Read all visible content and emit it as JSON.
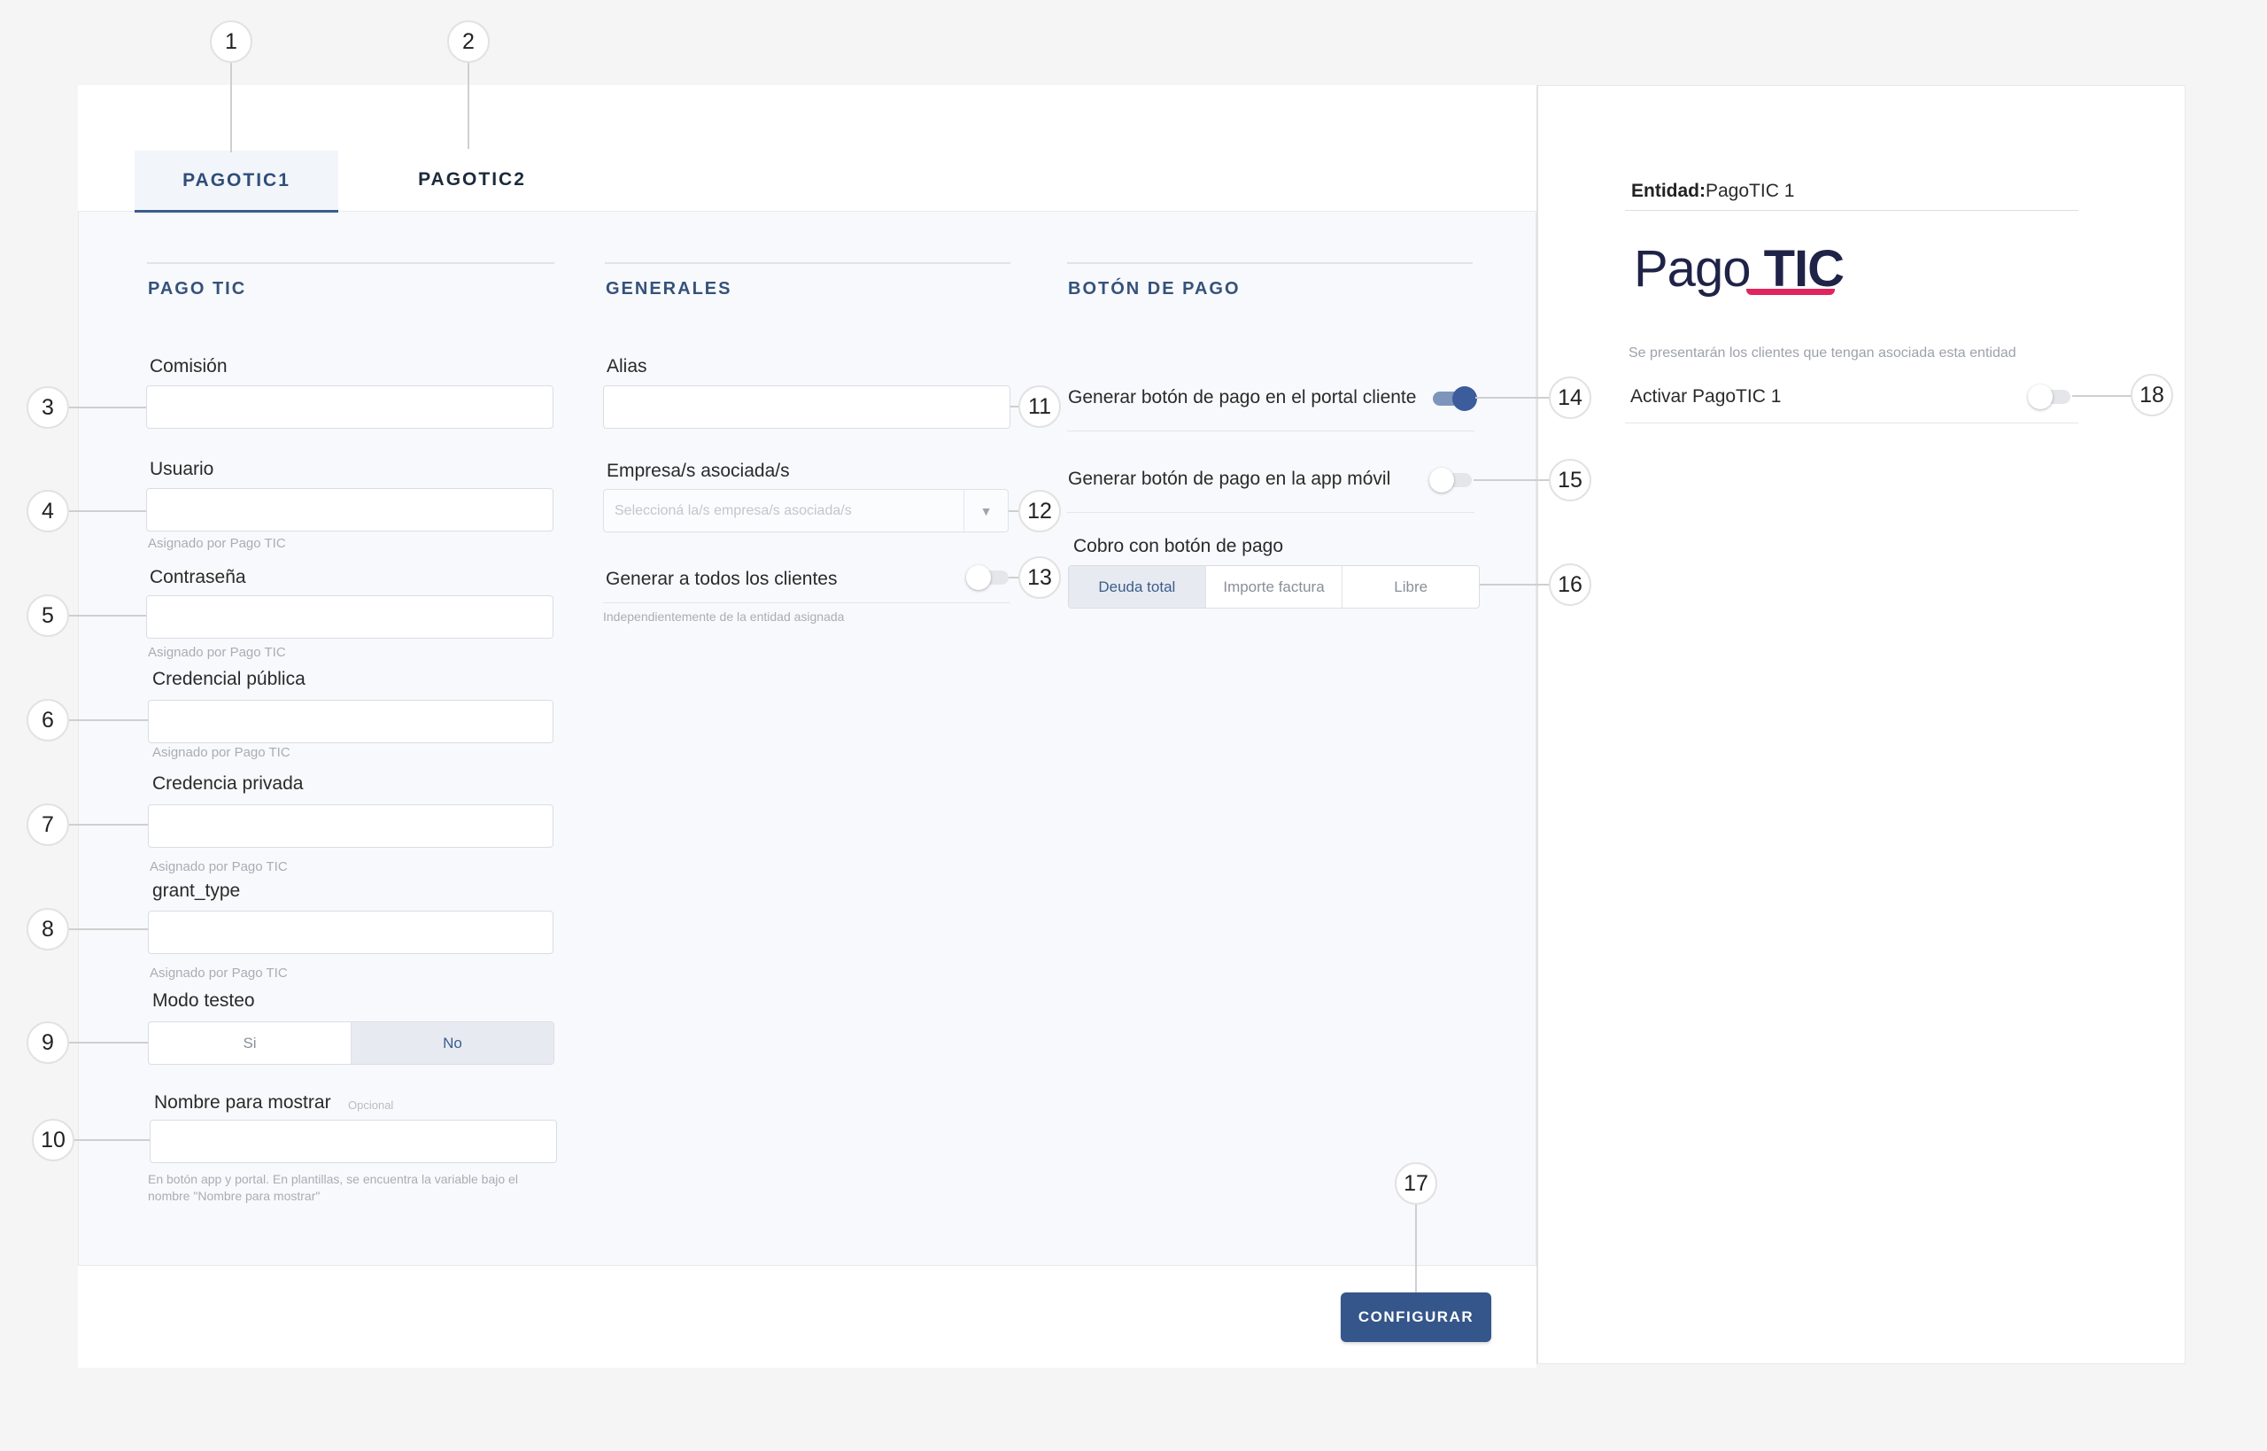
{
  "tabs": [
    {
      "label": "PAGOTIC1",
      "active": true
    },
    {
      "label": "PAGOTIC2",
      "active": false
    }
  ],
  "sections": {
    "pago_tic": "PAGO TIC",
    "generales": "GENERALES",
    "boton_pago": "BOTÓN DE PAGO"
  },
  "pago_tic": {
    "comision": {
      "label": "Comisión",
      "value": ""
    },
    "usuario": {
      "label": "Usuario",
      "value": "",
      "hint": "Asignado por Pago TIC"
    },
    "contrasena": {
      "label": "Contraseña",
      "value": "",
      "hint": "Asignado por Pago TIC"
    },
    "credencial_publica": {
      "label": "Credencial pública",
      "value": "",
      "hint": "Asignado por Pago TIC"
    },
    "credencia_privada": {
      "label": "Credencia privada",
      "value": "",
      "hint": "Asignado por Pago TIC"
    },
    "grant_type": {
      "label": "grant_type",
      "value": "",
      "hint": "Asignado por Pago TIC"
    },
    "modo_testeo": {
      "label": "Modo testeo",
      "options": [
        "Si",
        "No"
      ],
      "selected": "No"
    },
    "nombre_mostrar": {
      "label": "Nombre para mostrar",
      "optional": "Opcional",
      "value": "",
      "hint_line1": "En botón app y portal. En plantillas, se encuentra la variable bajo el",
      "hint_line2": "nombre \"Nombre para mostrar\""
    }
  },
  "generales": {
    "alias": {
      "label": "Alias",
      "value": ""
    },
    "empresas": {
      "label": "Empresa/s asociada/s",
      "placeholder": "Seleccioná la/s empresa/s asociada/s"
    },
    "todos_clientes": {
      "label": "Generar a todos los clientes",
      "on": false,
      "hint": "Independientemente de la entidad asignada"
    }
  },
  "boton_pago": {
    "portal": {
      "label": "Generar botón de pago en el portal cliente",
      "on": true
    },
    "app": {
      "label": "Generar botón de pago en la app móvil",
      "on": false
    },
    "cobro": {
      "label": "Cobro con botón de pago",
      "options": [
        "Deuda total",
        "Importe factura",
        "Libre"
      ],
      "selected": "Deuda total"
    }
  },
  "footer": {
    "configure": "CONFIGURAR"
  },
  "side": {
    "entidad_label": "Entidad:",
    "entidad_value": "PagoTIC 1",
    "logo_part1": "Pago",
    "logo_part2": "TIC",
    "description": "Se presentarán los clientes que tengan asociada esta entidad",
    "activar": {
      "label": "Activar PagoTIC 1",
      "on": false
    }
  },
  "callouts": [
    "1",
    "2",
    "3",
    "4",
    "5",
    "6",
    "7",
    "8",
    "9",
    "10",
    "11",
    "12",
    "13",
    "14",
    "15",
    "16",
    "17",
    "18"
  ],
  "colors": {
    "accent": "#34568a",
    "logo_bar": "#e0245e",
    "section_title": "#34527a"
  }
}
